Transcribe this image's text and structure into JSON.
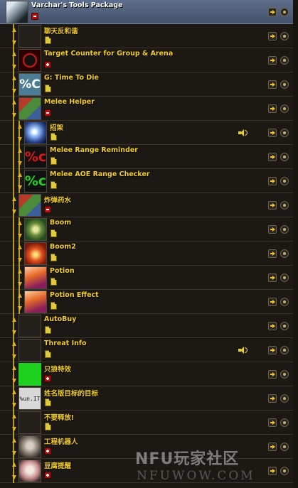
{
  "window": {
    "watermark_line1": "NFU玩家社区",
    "watermark_line2": "NFUWOW.COM"
  },
  "rows": [
    {
      "label": "Varchar's Tools Package",
      "depth": 0,
      "icon": "gun-icon",
      "toggle": "minus",
      "selected": true
    },
    {
      "label": "聊天反和谐",
      "depth": 1,
      "icon": "empty-slot",
      "toggle": "file"
    },
    {
      "label": "Target Counter for Group & Arena",
      "depth": 1,
      "icon": "skull-icon",
      "toggle": "plus"
    },
    {
      "label": "G: Time To Die",
      "depth": 1,
      "icon": "percent-c-icon",
      "icon_text": "%C",
      "toggle": "file"
    },
    {
      "label": "Melee Helper",
      "depth": 1,
      "icon": "melee-icon",
      "toggle": "minus"
    },
    {
      "label": "招架",
      "depth": 2,
      "icon": "star-burst-icon",
      "toggle": "file",
      "sound": true
    },
    {
      "label": "Melee Range Reminder",
      "depth": 2,
      "icon": "percent-red-icon",
      "icon_text": "%c",
      "icon_color": "#e01818",
      "toggle": "file"
    },
    {
      "label": "Melee AOE Range Checker",
      "depth": 2,
      "icon": "percent-green-icon",
      "icon_text": "%c",
      "icon_color": "#22d022",
      "toggle": "file"
    },
    {
      "label": "炸弹药水",
      "depth": 1,
      "icon": "bomb-potion-icon",
      "toggle": "minus"
    },
    {
      "label": "Boom",
      "depth": 2,
      "icon": "boom-icon",
      "toggle": "file"
    },
    {
      "label": "Boom2",
      "depth": 2,
      "icon": "explosion-icon",
      "toggle": "file"
    },
    {
      "label": "Potion",
      "depth": 2,
      "icon": "potion-icon",
      "toggle": "file"
    },
    {
      "label": "Potion Effect",
      "depth": 2,
      "icon": "potion-icon",
      "toggle": "file"
    },
    {
      "label": "AutoBuy",
      "depth": 1,
      "icon": "empty-slot",
      "toggle": "file"
    },
    {
      "label": "Threat Info",
      "depth": 1,
      "icon": "empty-slot",
      "toggle": "file",
      "sound": true
    },
    {
      "label": "只狼特效",
      "depth": 1,
      "icon": "green-square-icon",
      "toggle": "plus"
    },
    {
      "label": "姓名版目标的目标",
      "depth": 1,
      "icon": "unit-text-icon",
      "icon_text": "%un.IT",
      "toggle": "file"
    },
    {
      "label": "不要释放!",
      "depth": 1,
      "icon": "empty-slot",
      "toggle": "file"
    },
    {
      "label": "工程机器人",
      "depth": 1,
      "icon": "robot-icon",
      "toggle": "plus"
    },
    {
      "label": "豆腐提醒",
      "depth": 1,
      "icon": "cat-icon",
      "toggle": "plus"
    }
  ]
}
